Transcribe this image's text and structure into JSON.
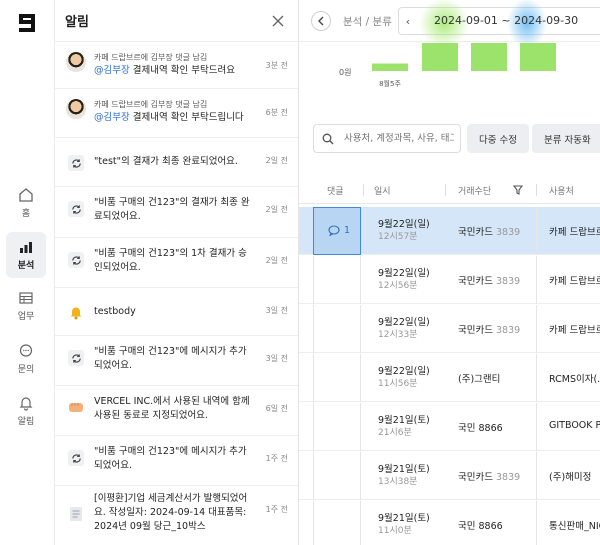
{
  "sidebar": {
    "logo": "logo",
    "items": [
      {
        "label": "홈",
        "icon": "home-icon"
      },
      {
        "label": "분석",
        "icon": "bar-chart-icon",
        "active": true
      },
      {
        "label": "업무",
        "icon": "table-icon"
      },
      {
        "label": "문의",
        "icon": "chat-icon"
      },
      {
        "label": "알림",
        "icon": "bell-icon"
      }
    ]
  },
  "notifications": {
    "title": "알림",
    "items": [
      {
        "icon": "avatar",
        "sub": "카페 드랍브르에 김부장 댓글 남김",
        "mention": "@김부장",
        "text": " 결제내역 확인 부탁드려요",
        "time": "3분 전"
      },
      {
        "icon": "avatar",
        "sub": "카페 드랍브르에 김부장 댓글 남김",
        "mention": "@김부장",
        "text": " 결제내역 확인 부탁드립니다",
        "time": "6분 전"
      },
      {
        "icon": "sync-icon",
        "text": "\"test\"의 결재가 최종 완료되었어요.",
        "time": "2일 전"
      },
      {
        "icon": "sync-icon",
        "text": "\"비품 구매의 건123\"의 결재가 최종 완료되었어요.",
        "time": "2일 전"
      },
      {
        "icon": "sync-icon",
        "text": "\"비품 구매의 건123\"의 1차 결재가 승인되었어요.",
        "time": "2일 전"
      },
      {
        "icon": "bell-icon",
        "text": "testbody",
        "time": "3일 전"
      },
      {
        "icon": "sync-icon",
        "text": "\"비품 구매의 건123\"에 메시지가 추가되었어요.",
        "time": "3일 전"
      },
      {
        "icon": "hand-icon",
        "text": "VERCEL INC.에서 사용된 내역에 함께 사용된 동료로 지정되었어요.",
        "time": "6일 전"
      },
      {
        "icon": "sync-icon",
        "text": "\"비품 구매의 건123\"에 메시지가 추가되었어요.",
        "time": "1주 전"
      },
      {
        "icon": "document-icon",
        "text": "[이평환]기업 세금계산서가 발행되었어요. 작성일자: 2024-09-14 대표품목: 2024년 09월 당근_10박스",
        "time": "1주 전"
      }
    ]
  },
  "topbar": {
    "back_icon": "chevron-left-icon",
    "breadcrumb": "분석 / 분류",
    "date_range": "2024-09-01 ~ 2024-09-30"
  },
  "chart_data": {
    "type": "bar",
    "ytick": "0원",
    "categories": [
      "8월5주",
      "",
      "",
      ""
    ],
    "values": [
      8,
      30,
      30,
      30
    ],
    "colors": [
      "#9be36a",
      "#9be36a",
      "#9be36a",
      "#9be36a"
    ]
  },
  "filters": {
    "search_placeholder": "사용처, 계정과목, 사유, 태그",
    "multi_edit": "다중 수정",
    "auto_classify": "분류 자동화"
  },
  "table": {
    "headers": [
      "댓글",
      "일시",
      "거래수단",
      "사용처"
    ],
    "rows": [
      {
        "reply_count": "1",
        "date": "9월22일(일)",
        "time": "12시57분",
        "method": "국민카드",
        "card_no": "3839",
        "merchant": "카페 드랍브르",
        "selected": true
      },
      {
        "reply_count": "",
        "date": "9월22일(일)",
        "time": "12시56분",
        "method": "국민카드",
        "card_no": "3839",
        "merchant": "카페 드랍브르"
      },
      {
        "reply_count": "",
        "date": "9월22일(일)",
        "time": "12시33분",
        "method": "국민카드",
        "card_no": "3839",
        "merchant": "카페 드랍브르"
      },
      {
        "reply_count": "",
        "date": "9월22일(일)",
        "time": "11시56분",
        "method": "(주)그랜티",
        "card_no": "",
        "merchant": "RCMS이자(..."
      },
      {
        "reply_count": "",
        "date": "9월21일(토)",
        "time": "21시6분",
        "method": "국민 8866",
        "card_no": "",
        "merchant": "GITBOOK PTE"
      },
      {
        "reply_count": "",
        "date": "9월21일(토)",
        "time": "13시38분",
        "method": "국민카드",
        "card_no": "3839",
        "merchant": "(주)해미정"
      },
      {
        "reply_count": "",
        "date": "9월21일(토)",
        "time": "11시0분",
        "method": "국민 8866",
        "card_no": "",
        "merchant": "통신판매_NICE"
      }
    ]
  }
}
